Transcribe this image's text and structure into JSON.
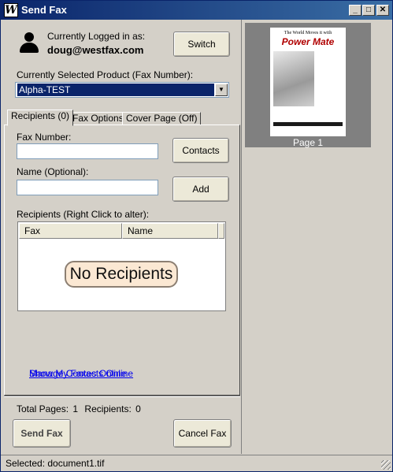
{
  "window": {
    "title": "Send Fax",
    "logo_letter": "W",
    "minimize_glyph": "_",
    "maximize_glyph": "□",
    "close_glyph": "✕"
  },
  "user": {
    "logged_label": "Currently Logged in as:",
    "email": "doug@westfax.com",
    "switch_label": "Switch"
  },
  "product": {
    "label": "Currently Selected Product (Fax Number):",
    "selected": "Alpha-TEST",
    "arrow": "▼"
  },
  "tabs": [
    {
      "label": "Recipients (0)",
      "active": true
    },
    {
      "label": "Fax Options",
      "active": false
    },
    {
      "label": "Cover Page (Off)",
      "active": false
    }
  ],
  "recipients": {
    "fax_number_label": "Fax Number:",
    "fax_number_value": "",
    "contacts_label": "Contacts",
    "name_label": "Name (Optional):",
    "name_value": "",
    "add_label": "Add",
    "list_label": "Recipients (Right Click to alter):",
    "columns": [
      "Fax",
      "Name"
    ],
    "empty_message": "No Recipients"
  },
  "links": {
    "manage_contacts": "Manage Contacts Online",
    "show_faxes": "Show My Faxes Online"
  },
  "totals": {
    "pages_label": "Total Pages:",
    "pages_value": "1",
    "recipients_label": "Recipients:",
    "recipients_value": "0"
  },
  "actions": {
    "send_label": "Send Fax",
    "cancel_label": "Cancel Fax"
  },
  "preview": {
    "page_label": "Page 1",
    "thumb_tagline": "The World Moves it with",
    "thumb_brand": "Power Mate"
  },
  "status": {
    "text": "Selected: document1.tif"
  },
  "icons": {
    "user": "user-icon",
    "app": "westfax-logo-icon",
    "dropdown": "chevron-down-icon",
    "resize": "resize-grip-icon"
  }
}
